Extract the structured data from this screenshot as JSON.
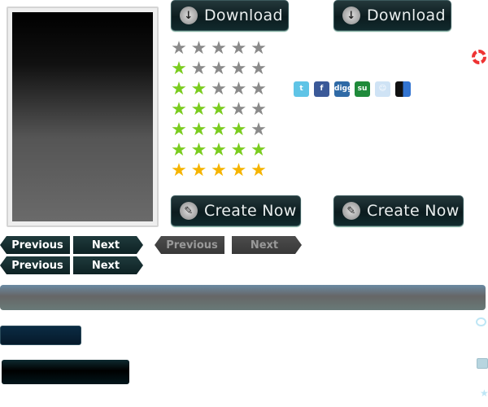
{
  "buttons": {
    "download_1": "Download",
    "download_2": "Download",
    "create_1": "Create Now",
    "create_2": "Create Now"
  },
  "pagination": {
    "row1": {
      "previous": "Previous",
      "next": "Next"
    },
    "row2": {
      "previous": "Previous",
      "next": "Next"
    },
    "disabled": {
      "previous": "Previous",
      "next": "Next"
    }
  },
  "ratings": [
    {
      "filled": 0,
      "color": "gray"
    },
    {
      "filled": 1,
      "color": "green"
    },
    {
      "filled": 2,
      "color": "green"
    },
    {
      "filled": 3,
      "color": "green"
    },
    {
      "filled": 4,
      "color": "green"
    },
    {
      "filled": 5,
      "color": "green"
    },
    {
      "filled": 5,
      "color": "gold"
    }
  ],
  "ratings_max": 5,
  "social_icons": [
    {
      "name": "twitter-icon",
      "label": "t",
      "color": "#5fc4e6"
    },
    {
      "name": "facebook-icon",
      "label": "f",
      "color": "#3b5998"
    },
    {
      "name": "digg-icon",
      "label": "digg",
      "color": "#2f6aa6"
    },
    {
      "name": "stumbleupon-icon",
      "label": "su",
      "color": "#1f8a3a"
    },
    {
      "name": "reddit-icon",
      "label": "☺",
      "color": "#cfe3f5"
    },
    {
      "name": "delicious-icon",
      "label": "",
      "color": "#3274d1"
    }
  ],
  "colors": {
    "green": "#7acc1e",
    "gold": "#f5b400",
    "gray": "#8a8a8a"
  }
}
